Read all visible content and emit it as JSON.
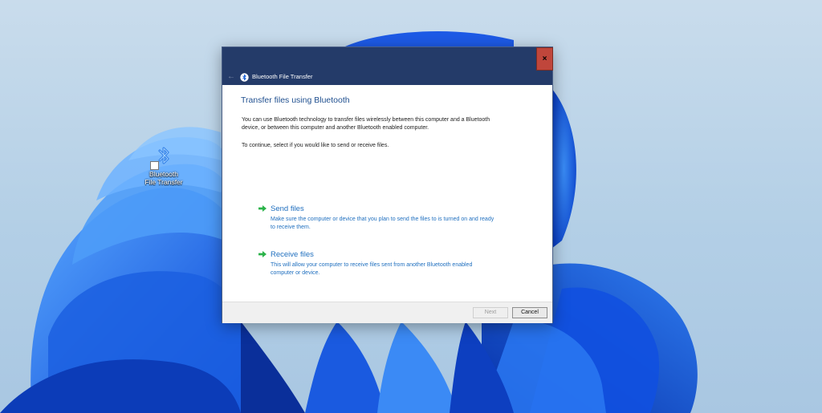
{
  "desktop": {
    "icon": {
      "icon_name": "bluetooth-icon",
      "caption_line1": "Bluetooth",
      "caption_line2": "File Transfer"
    }
  },
  "window": {
    "title": "Bluetooth File Transfer",
    "close_label": "×",
    "back_label": "←",
    "accent_color": "#243b69"
  },
  "main": {
    "heading": "Transfer files using Bluetooth",
    "intro": "You can use Bluetooth technology to transfer files wirelessly between this computer and a Bluetooth device, or between this computer and another Bluetooth enabled computer.",
    "instruction": "To continue, select if you would like to send or receive files.",
    "options": [
      {
        "title": "Send files",
        "description": "Make sure the computer or device that you plan to send the files to is turned on and ready to receive them."
      },
      {
        "title": "Receive files",
        "description": "This will allow your computer to receive files sent from another Bluetooth enabled computer or device."
      }
    ]
  },
  "footer": {
    "next_label": "Next",
    "cancel_label": "Cancel"
  }
}
